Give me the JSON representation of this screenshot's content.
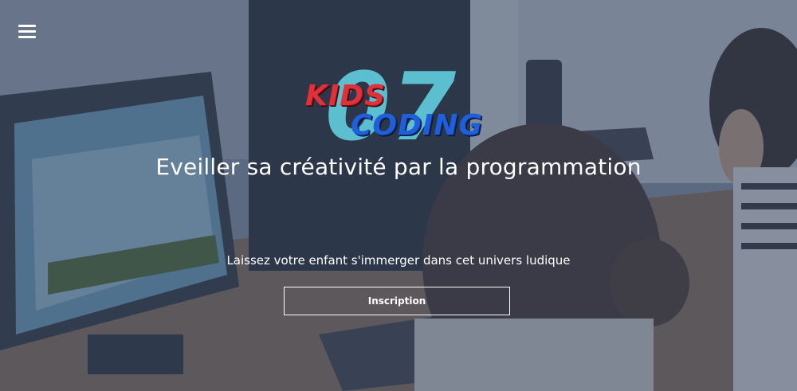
{
  "nav": {
    "menu_icon": "hamburger-menu-icon"
  },
  "logo": {
    "number": "07",
    "word1": "KIDS",
    "word2": "CODING",
    "colors": {
      "number": "#5fc7d8",
      "word1": "#e0303a",
      "word2": "#1f5fd9"
    }
  },
  "hero": {
    "headline": "Eveiller sa créativité par la programmation",
    "subtitle": "Laissez votre enfant s'immerger dans cet univers ludique",
    "cta_label": "Inscription"
  },
  "colors": {
    "overlay": "#37465f",
    "text": "#ffffff"
  }
}
